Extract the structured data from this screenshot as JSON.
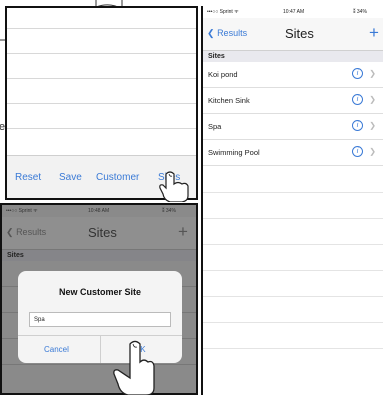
{
  "edge_fragment": "e",
  "panel_a": {
    "toolbar": {
      "reset": "Reset",
      "save": "Save",
      "customer": "Customer",
      "sites": "Sites"
    }
  },
  "panel_b": {
    "status": {
      "carrier": "•••○○ Sprint ᯤ",
      "time": "10:47 AM",
      "battery": "⁑ 34%"
    },
    "nav": {
      "back": "Results",
      "title": "Sites",
      "plus": "+"
    },
    "section": "Sites",
    "rows": [
      {
        "label": "Koi pond"
      },
      {
        "label": "Kitchen Sink"
      },
      {
        "label": "Spa"
      },
      {
        "label": "Swimming Pool"
      }
    ]
  },
  "panel_c": {
    "status": {
      "carrier": "•••○○ Sprint ᯤ",
      "time": "10:48 AM",
      "battery": "⁑ 34%"
    },
    "nav": {
      "back": "Results",
      "title": "Sites",
      "plus": "+"
    },
    "section": "Sites",
    "dialog": {
      "title": "New Customer Site",
      "input_value": "Spa",
      "cancel": "Cancel",
      "ok": "OK"
    }
  },
  "colors": {
    "accent": "#3a7ad6",
    "border": "#111111"
  }
}
